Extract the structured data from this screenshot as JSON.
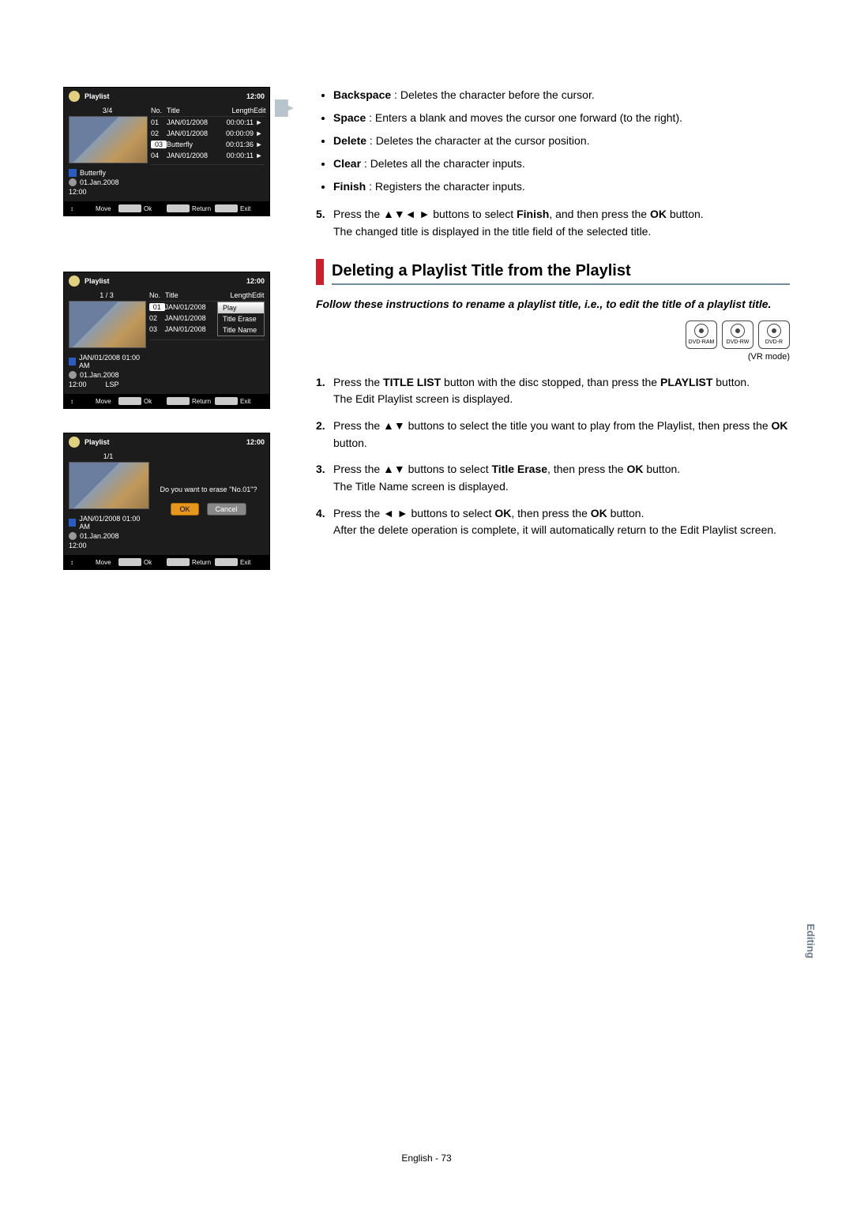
{
  "bullets": {
    "backspace": {
      "term": "Backspace",
      "desc": " : Deletes the character before the cursor."
    },
    "space": {
      "term": "Space",
      "desc": " : Enters a blank and moves the cursor one forward (to the right)."
    },
    "delete": {
      "term": "Delete",
      "desc": " : Deletes the character at the cursor position."
    },
    "clear": {
      "term": "Clear",
      "desc": " : Deletes all the character inputs."
    },
    "finish": {
      "term": "Finish",
      "desc": " : Registers the character inputs."
    }
  },
  "step5": {
    "num": "5.",
    "l1a": "Press the ▲▼◄ ► buttons to select ",
    "l1b": "Finish",
    "l1c": ", and then press the ",
    "l1d": "OK",
    "l1e": " button.",
    "l2": "The changed title is displayed in the title field of the selected title."
  },
  "heading": "Deleting a Playlist Title from the Playlist",
  "intro": "Follow these instructions to rename a playlist title, i.e., to edit the title of a playlist  title.",
  "modes": {
    "a": "DVD-RAM",
    "b": "DVD-RW",
    "c": "DVD-R",
    "caption": "(VR mode)"
  },
  "s1": {
    "num": "1.",
    "a": "Press the ",
    "b": "TITLE LIST",
    "c": " button with the disc stopped, than press the ",
    "d": "PLAYLIST",
    "e": " button.",
    "l2": "The Edit Playlist screen is displayed."
  },
  "s2": {
    "num": "2.",
    "a": "Press the ▲▼ buttons to select the title you want to play from the Playlist, then press the ",
    "b": "OK",
    "c": " button."
  },
  "s3": {
    "num": "3.",
    "a": "Press the ▲▼ buttons to select ",
    "b": "Title Erase",
    "c": ", then press the ",
    "d": "OK",
    "e": " button.",
    "l2": "The Title Name screen is displayed."
  },
  "s4": {
    "num": "4.",
    "a": "Press the ◄ ► buttons to select ",
    "b": "OK",
    "c": ", then press the ",
    "d": "OK",
    "e": " button.",
    "l2": "After the delete operation is complete, it will automatically return to the Edit Playlist screen."
  },
  "sidetab": "Editing",
  "footer": "English - 73",
  "ss_common": {
    "title": "Playlist",
    "clock": "12:00",
    "hdr": {
      "no": "No.",
      "title": "Title",
      "len": "Length",
      "edit": "Edit"
    },
    "foot": {
      "move": "Move",
      "ok": "Ok",
      "ret": "Return",
      "exit": "Exit"
    },
    "arrow": "►",
    "updown": "↕",
    "keyok": "⏎",
    "keyret": "↶",
    "keyexit": "⏏"
  },
  "ss1": {
    "counter": "3/4",
    "rows": [
      {
        "no": "01",
        "title": "JAN/01/2008",
        "len": "00:00:11"
      },
      {
        "no": "02",
        "title": "JAN/01/2008",
        "len": "00:00:09"
      },
      {
        "no": "03",
        "title": "Butterfly",
        "len": "00:01:36",
        "sel": true
      },
      {
        "no": "04",
        "title": "JAN/01/2008",
        "len": "00:00:11"
      }
    ],
    "meta": {
      "name": "Butterfly",
      "date": "01.Jan.2008",
      "time": "12:00"
    }
  },
  "ss2": {
    "counter": "1 / 3",
    "rows": [
      {
        "no": "01",
        "title": "JAN/01/2008",
        "menu": "Play",
        "sel": true
      },
      {
        "no": "02",
        "title": "JAN/01/2008",
        "menu": "Title Erase"
      },
      {
        "no": "03",
        "title": "JAN/01/2008",
        "menu": "Title Name"
      }
    ],
    "meta": {
      "name": "JAN/01/2008 01:00 AM",
      "date": "01.Jan.2008",
      "time": "12:00",
      "mode": "LSP"
    }
  },
  "ss3": {
    "counter": "1/1",
    "msg": "Do you want to erase \"No.01\"?",
    "ok": "OK",
    "cancel": "Cancel",
    "meta": {
      "name": "JAN/01/2008 01:00 AM",
      "date": "01.Jan.2008",
      "time": "12:00"
    }
  }
}
